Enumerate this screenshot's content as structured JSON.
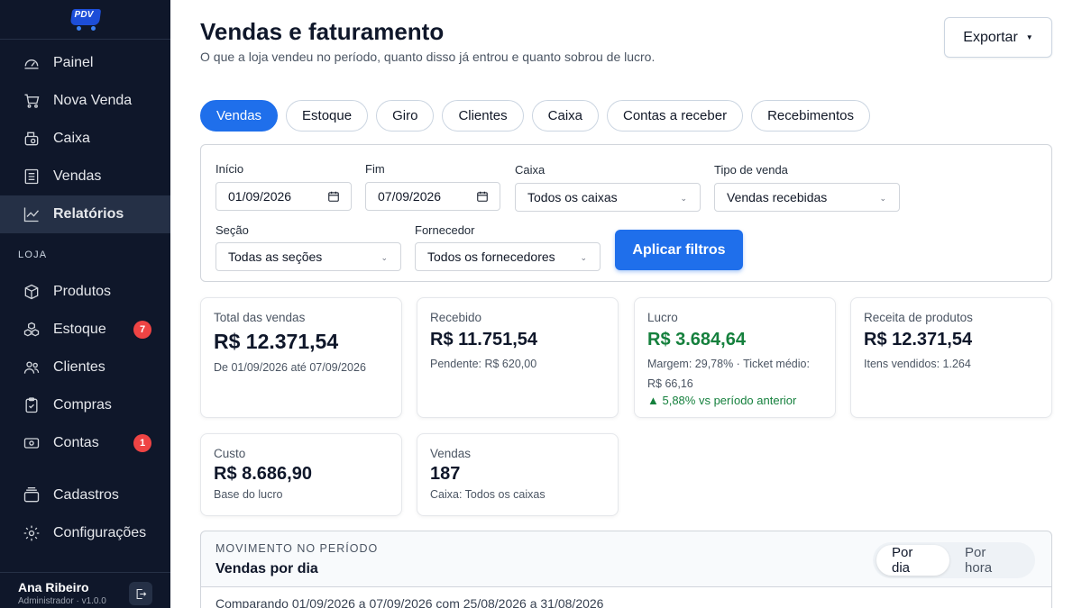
{
  "app": {
    "logo_text": "PDV"
  },
  "sidebar": {
    "top_items": [
      {
        "label": "Painel",
        "icon": "gauge-icon"
      },
      {
        "label": "Nova Venda",
        "icon": "cart-icon"
      },
      {
        "label": "Caixa",
        "icon": "cash-register-icon"
      },
      {
        "label": "Vendas",
        "icon": "receipt-list-icon"
      },
      {
        "label": "Relatórios",
        "icon": "chart-line-icon",
        "active": true
      }
    ],
    "section_label": "LOJA",
    "store_items": [
      {
        "label": "Produtos",
        "icon": "box-icon"
      },
      {
        "label": "Estoque",
        "icon": "boxes-stack-icon",
        "badge": "7"
      },
      {
        "label": "Clientes",
        "icon": "users-icon"
      },
      {
        "label": "Compras",
        "icon": "clipboard-icon"
      },
      {
        "label": "Contas",
        "icon": "money-bill-icon",
        "badge": "1"
      }
    ],
    "bottom_items": [
      {
        "label": "Cadastros",
        "icon": "folder-stack-icon"
      },
      {
        "label": "Configurações",
        "icon": "gear-icon"
      }
    ],
    "user": {
      "name": "Ana Ribeiro",
      "role": "Administrador · v1.0.0"
    }
  },
  "header": {
    "title": "Vendas e faturamento",
    "subtitle": "O que a loja vendeu no período, quanto disso já entrou e quanto sobrou de lucro.",
    "export_label": "Exportar"
  },
  "tabs": [
    {
      "label": "Vendas",
      "active": true
    },
    {
      "label": "Estoque"
    },
    {
      "label": "Giro"
    },
    {
      "label": "Clientes"
    },
    {
      "label": "Caixa"
    },
    {
      "label": "Contas a receber"
    },
    {
      "label": "Recebimentos"
    }
  ],
  "filters": {
    "start": {
      "label": "Início",
      "value": "01/09/2026"
    },
    "end": {
      "label": "Fim",
      "value": "07/09/2026"
    },
    "register": {
      "label": "Caixa",
      "value": "Todos os caixas"
    },
    "sale_type": {
      "label": "Tipo de venda",
      "value": "Vendas recebidas"
    },
    "section": {
      "label": "Seção",
      "value": "Todas as seções"
    },
    "supplier": {
      "label": "Fornecedor",
      "value": "Todos os fornecedores"
    },
    "apply_label": "Aplicar filtros"
  },
  "cards": {
    "total": {
      "title": "Total das vendas",
      "value": "R$ 12.371,54",
      "sub": "De 01/09/2026 até 07/09/2026"
    },
    "received": {
      "title": "Recebido",
      "value": "R$ 11.751,54",
      "sub": "Pendente: R$ 620,00"
    },
    "profit": {
      "title": "Lucro",
      "value": "R$ 3.684,64",
      "sub": "Margem: 29,78% · Ticket médio: R$ 66,16",
      "trend": "▲ 5,88% vs período anterior"
    },
    "products": {
      "title": "Receita de produtos",
      "value": "R$ 12.371,54",
      "sub": "Itens vendidos: 1.264"
    },
    "cost": {
      "title": "Custo",
      "value": "R$ 8.686,90",
      "sub": "Base do lucro"
    },
    "sales": {
      "title": "Vendas",
      "value": "187",
      "sub": "Caixa: Todos os caixas"
    }
  },
  "movement": {
    "kicker": "MOVIMENTO NO PERÍODO",
    "title": "Vendas por dia",
    "toggle_day": "Por dia",
    "toggle_hour": "Por hora",
    "compare": "Comparando 01/09/2026 a 07/09/2026 com 25/08/2026 a 31/08/2026"
  },
  "colors": {
    "accent": "#1f6feb",
    "sidebar_bg": "#0f172a",
    "positive": "#15803d",
    "badge": "#ef4444"
  }
}
